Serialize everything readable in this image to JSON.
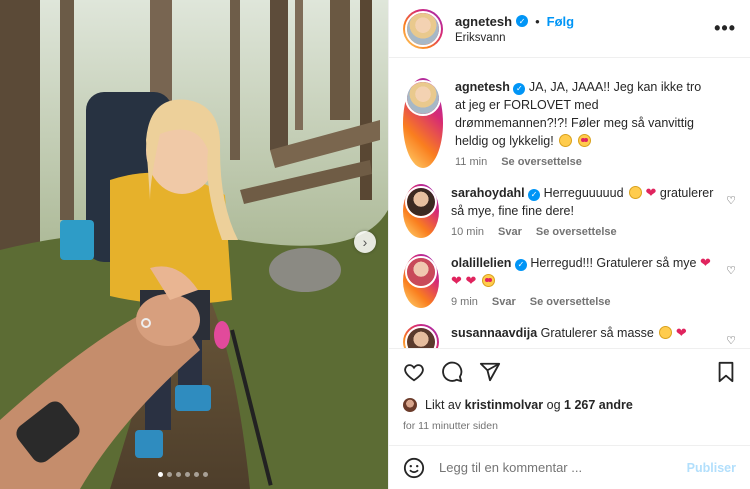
{
  "post": {
    "username": "agnetesh",
    "follow_label": "Følg",
    "separator": "•",
    "location": "Eriksvann",
    "more_label": "•••"
  },
  "caption": {
    "username": "agnetesh",
    "text": "JA, JA, JAAA!! Jeg kan ikke tro at jeg er FORLOVET med drømmemannen?!?! Føler meg så vanvittig heldig og lykkelig!",
    "time": "11 min",
    "translate": "Se oversettelse"
  },
  "comments": [
    {
      "username": "sarahoydahl",
      "text": "Herreguuuuud",
      "text_after": "gratulerer så mye, fine fine dere!",
      "time": "10 min",
      "reply": "Svar",
      "translate": "Se oversettelse"
    },
    {
      "username": "olalillelien",
      "text": "Herregud!!! Gratulerer så mye",
      "time": "9 min",
      "reply": "Svar",
      "translate": "Se oversettelse"
    },
    {
      "username": "susannaavdija",
      "text": "Gratulerer så masse"
    }
  ],
  "likes": {
    "prefix": "Likt av",
    "user": "kristinmolvar",
    "connector": "og",
    "count": "1 267 andre"
  },
  "date": "for 11 minutter siden",
  "add_comment": {
    "placeholder": "Legg til en kommentar ...",
    "post_label": "Publiser"
  },
  "carousel": {
    "slides": 6,
    "active_index": 0
  },
  "colors": {
    "accent": "#0095f6",
    "post_disabled": "#b2dffc",
    "heart": "#e0245e"
  }
}
